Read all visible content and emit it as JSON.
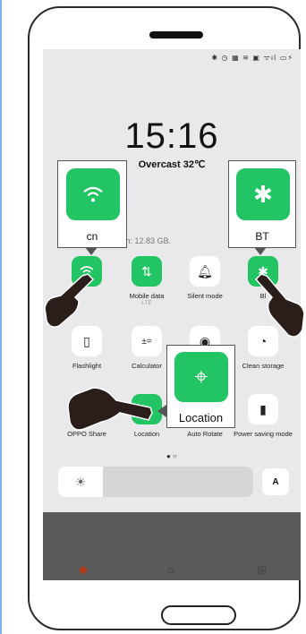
{
  "status_bar": {
    "icons_text": "✱ ◷ ▦ ≋ ▣ ᯤıl ▭⚡"
  },
  "lockscreen": {
    "time": "15:16",
    "weather": "Overcast 32℃",
    "data_usage": "onth: 12.83 GB."
  },
  "tiles": [
    {
      "name": "wifi",
      "label": "",
      "icon": "wifi-icon",
      "active": true
    },
    {
      "name": "mobile-data",
      "label": "Mobile data",
      "sub": "LTE",
      "icon": "mobile-data-icon",
      "active": true
    },
    {
      "name": "silent-mode",
      "label": "Silent mode",
      "icon": "bell-icon",
      "active": false
    },
    {
      "name": "bluetooth",
      "label": "BT",
      "icon": "bluetooth-icon",
      "active": true
    },
    {
      "name": "flashlight",
      "label": "Flashlight",
      "icon": "flashlight-icon",
      "active": false
    },
    {
      "name": "calculator",
      "label": "Calculator",
      "icon": "calculator-icon",
      "active": false
    },
    {
      "name": "eye-comfort",
      "label": "",
      "icon": "eye-icon",
      "active": false
    },
    {
      "name": "clean-storage",
      "label": "Clean storage",
      "icon": "gauge-icon",
      "active": false
    },
    {
      "name": "oppo-share",
      "label": "OPPO Share",
      "icon": "share-icon",
      "active": false
    },
    {
      "name": "location",
      "label": "Location",
      "icon": "location-pin-icon",
      "active": true
    },
    {
      "name": "auto-rotate",
      "label": "Auto Rotate",
      "icon": "rotate-icon",
      "active": false
    },
    {
      "name": "power-saving",
      "label": "Power saving mode",
      "icon": "battery-icon",
      "active": false
    }
  ],
  "brightness": {
    "auto_label": "A"
  },
  "callouts": {
    "wifi": "cn",
    "bt": "BT",
    "location": "Location"
  },
  "colors": {
    "accent": "#22c463",
    "screen_bg": "#e9e9eb",
    "bottom_band": "#5a5a5a"
  }
}
